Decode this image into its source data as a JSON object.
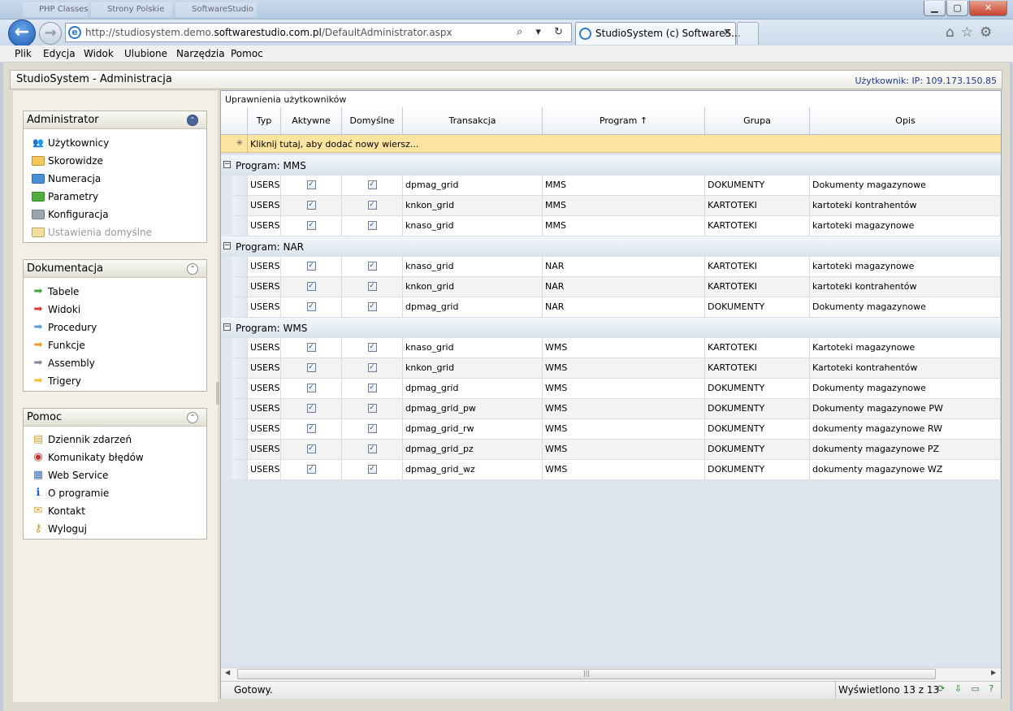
{
  "browser": {
    "ghost_tabs": [
      "PHP Classes",
      "Strony Polskie",
      "SoftwareStudio"
    ],
    "window_buttons": {
      "minimize": "▁",
      "maximize": "▢",
      "close": "✕"
    },
    "address_prefix": "http://studiosystem.demo.",
    "address_host": "softwarestudio.com.pl",
    "address_suffix": "/DefaultAdministrator.aspx",
    "address_icons": "⌕ ▾ ↻ ✕",
    "tab_title": "StudioSystem (c) SoftwareS...",
    "tab_close": "✕",
    "tool_icons": "⌂☆⚙",
    "back_glyph": "←",
    "forward_glyph": "→"
  },
  "menu": [
    "Plik",
    "Edycja",
    "Widok",
    "Ulubione",
    "Narzędzia",
    "Pomoc"
  ],
  "app": {
    "title": "StudioSystem - Administracja",
    "user_info": "Użytkownik: IP: 109.173.150.85"
  },
  "panels": {
    "admin": {
      "title": "Administrator",
      "collapse": "⌃",
      "items": [
        {
          "label": "Użytkownicy",
          "icon": "users-icon",
          "color": "#3b7fd1"
        },
        {
          "label": "Skorowidze",
          "icon": "folder-icon",
          "color": "#f2c75c"
        },
        {
          "label": "Numeracja",
          "icon": "folder-icon",
          "color": "#4a90d9"
        },
        {
          "label": "Parametry",
          "icon": "folder-icon",
          "color": "#4caf3c"
        },
        {
          "label": "Konfiguracja",
          "icon": "folder-icon",
          "color": "#9aa4b0"
        },
        {
          "label": "Ustawienia domyślne",
          "icon": "folder-icon",
          "color": "#f5dd9a"
        }
      ]
    },
    "docs": {
      "title": "Dokumentacja",
      "collapse": "⌃",
      "items": [
        {
          "label": "Tabele",
          "icon": "arrow-right-icon",
          "color": "#3aa63a"
        },
        {
          "label": "Widoki",
          "icon": "arrow-right-icon",
          "color": "#d93a3a"
        },
        {
          "label": "Procedury",
          "icon": "arrow-right-icon",
          "color": "#5b9ae0"
        },
        {
          "label": "Funkcje",
          "icon": "arrow-right-icon",
          "color": "#f0a020"
        },
        {
          "label": "Assembly",
          "icon": "arrow-right-icon",
          "color": "#7a8a9a"
        },
        {
          "label": "Trigery",
          "icon": "arrow-right-icon",
          "color": "#f0c030"
        }
      ]
    },
    "help": {
      "title": "Pomoc",
      "collapse": "⌃",
      "items": [
        {
          "label": "Dziennik zdarzeń",
          "icon": "journal-icon",
          "glyph": "▤",
          "color": "#d9a030"
        },
        {
          "label": "Komunikaty błędów",
          "icon": "error-icon",
          "glyph": "◉",
          "color": "#c0392b"
        },
        {
          "label": "Web Service",
          "icon": "web-service-icon",
          "glyph": "▦",
          "color": "#3a6fb5"
        },
        {
          "label": "O programie",
          "icon": "info-icon",
          "glyph": "ℹ",
          "color": "#1f5fbf"
        },
        {
          "label": "Kontakt",
          "icon": "mail-icon",
          "glyph": "✉",
          "color": "#d9a030"
        },
        {
          "label": "Wyloguj",
          "icon": "key-icon",
          "glyph": "⚷",
          "color": "#c9962a"
        }
      ]
    }
  },
  "grid": {
    "title": "Uprawnienia użytkowników",
    "columns": [
      "Typ",
      "Aktywne",
      "Domyślne",
      "Transakcja",
      "Program ↑",
      "Grupa",
      "Opis"
    ],
    "new_row_marker": "✳",
    "new_row_text": "Kliknij tutaj, aby dodać nowy wiersz...",
    "check_glyph": "✓",
    "groups": [
      {
        "label": "Program: MMS",
        "toggle": "−",
        "rows": [
          {
            "typ": "USERS",
            "transakcja": "dpmag_grid",
            "program": "MMS",
            "grupa": "DOKUMENTY",
            "opis": "Dokumenty magazynowe"
          },
          {
            "typ": "USERS",
            "transakcja": "knkon_grid",
            "program": "MMS",
            "grupa": "KARTOTEKI",
            "opis": "kartoteki kontrahentów"
          },
          {
            "typ": "USERS",
            "transakcja": "knaso_grid",
            "program": "MMS",
            "grupa": "KARTOTEKI",
            "opis": "kartoteki magazynowe"
          }
        ]
      },
      {
        "label": "Program: NAR",
        "toggle": "−",
        "rows": [
          {
            "typ": "USERS",
            "transakcja": "knaso_grid",
            "program": "NAR",
            "grupa": "KARTOTEKI",
            "opis": "kartoteki magazynowe"
          },
          {
            "typ": "USERS",
            "transakcja": "knkon_grid",
            "program": "NAR",
            "grupa": "KARTOTEKI",
            "opis": "kartoteki kontrahentów"
          },
          {
            "typ": "USERS",
            "transakcja": "dpmag_grid",
            "program": "NAR",
            "grupa": "DOKUMENTY",
            "opis": "Dokumenty magazynowe"
          }
        ]
      },
      {
        "label": "Program: WMS",
        "toggle": "−",
        "rows": [
          {
            "typ": "USERS",
            "transakcja": "knaso_grid",
            "program": "WMS",
            "grupa": "KARTOTEKI",
            "opis": "Kartoteki magazynowe"
          },
          {
            "typ": "USERS",
            "transakcja": "knkon_grid",
            "program": "WMS",
            "grupa": "KARTOTEKI",
            "opis": "Kartoteki kontrahentów"
          },
          {
            "typ": "USERS",
            "transakcja": "dpmag_grid",
            "program": "WMS",
            "grupa": "DOKUMENTY",
            "opis": "Dokumenty magazynowe"
          },
          {
            "typ": "USERS",
            "transakcja": "dpmag_grid_pw",
            "program": "WMS",
            "grupa": "DOKUMENTY",
            "opis": "Dokumenty magazynowe PW"
          },
          {
            "typ": "USERS",
            "transakcja": "dpmag_grid_rw",
            "program": "WMS",
            "grupa": "DOKUMENTY",
            "opis": "dokumenty magazynowe RW"
          },
          {
            "typ": "USERS",
            "transakcja": "dpmag_grid_pz",
            "program": "WMS",
            "grupa": "DOKUMENTY",
            "opis": "dokumenty magazynowe PZ"
          },
          {
            "typ": "USERS",
            "transakcja": "dpmag_grid_wz",
            "program": "WMS",
            "grupa": "DOKUMENTY",
            "opis": "dokumenty magazynowe WZ"
          }
        ]
      }
    ],
    "scroll_left": "◀",
    "scroll_right": "▶",
    "scroll_grip": "|||"
  },
  "status": {
    "text": "Gotowy.",
    "count": "Wyświetlono 13 z 13",
    "icons": "⟳ ⇩ ▭ ?"
  }
}
